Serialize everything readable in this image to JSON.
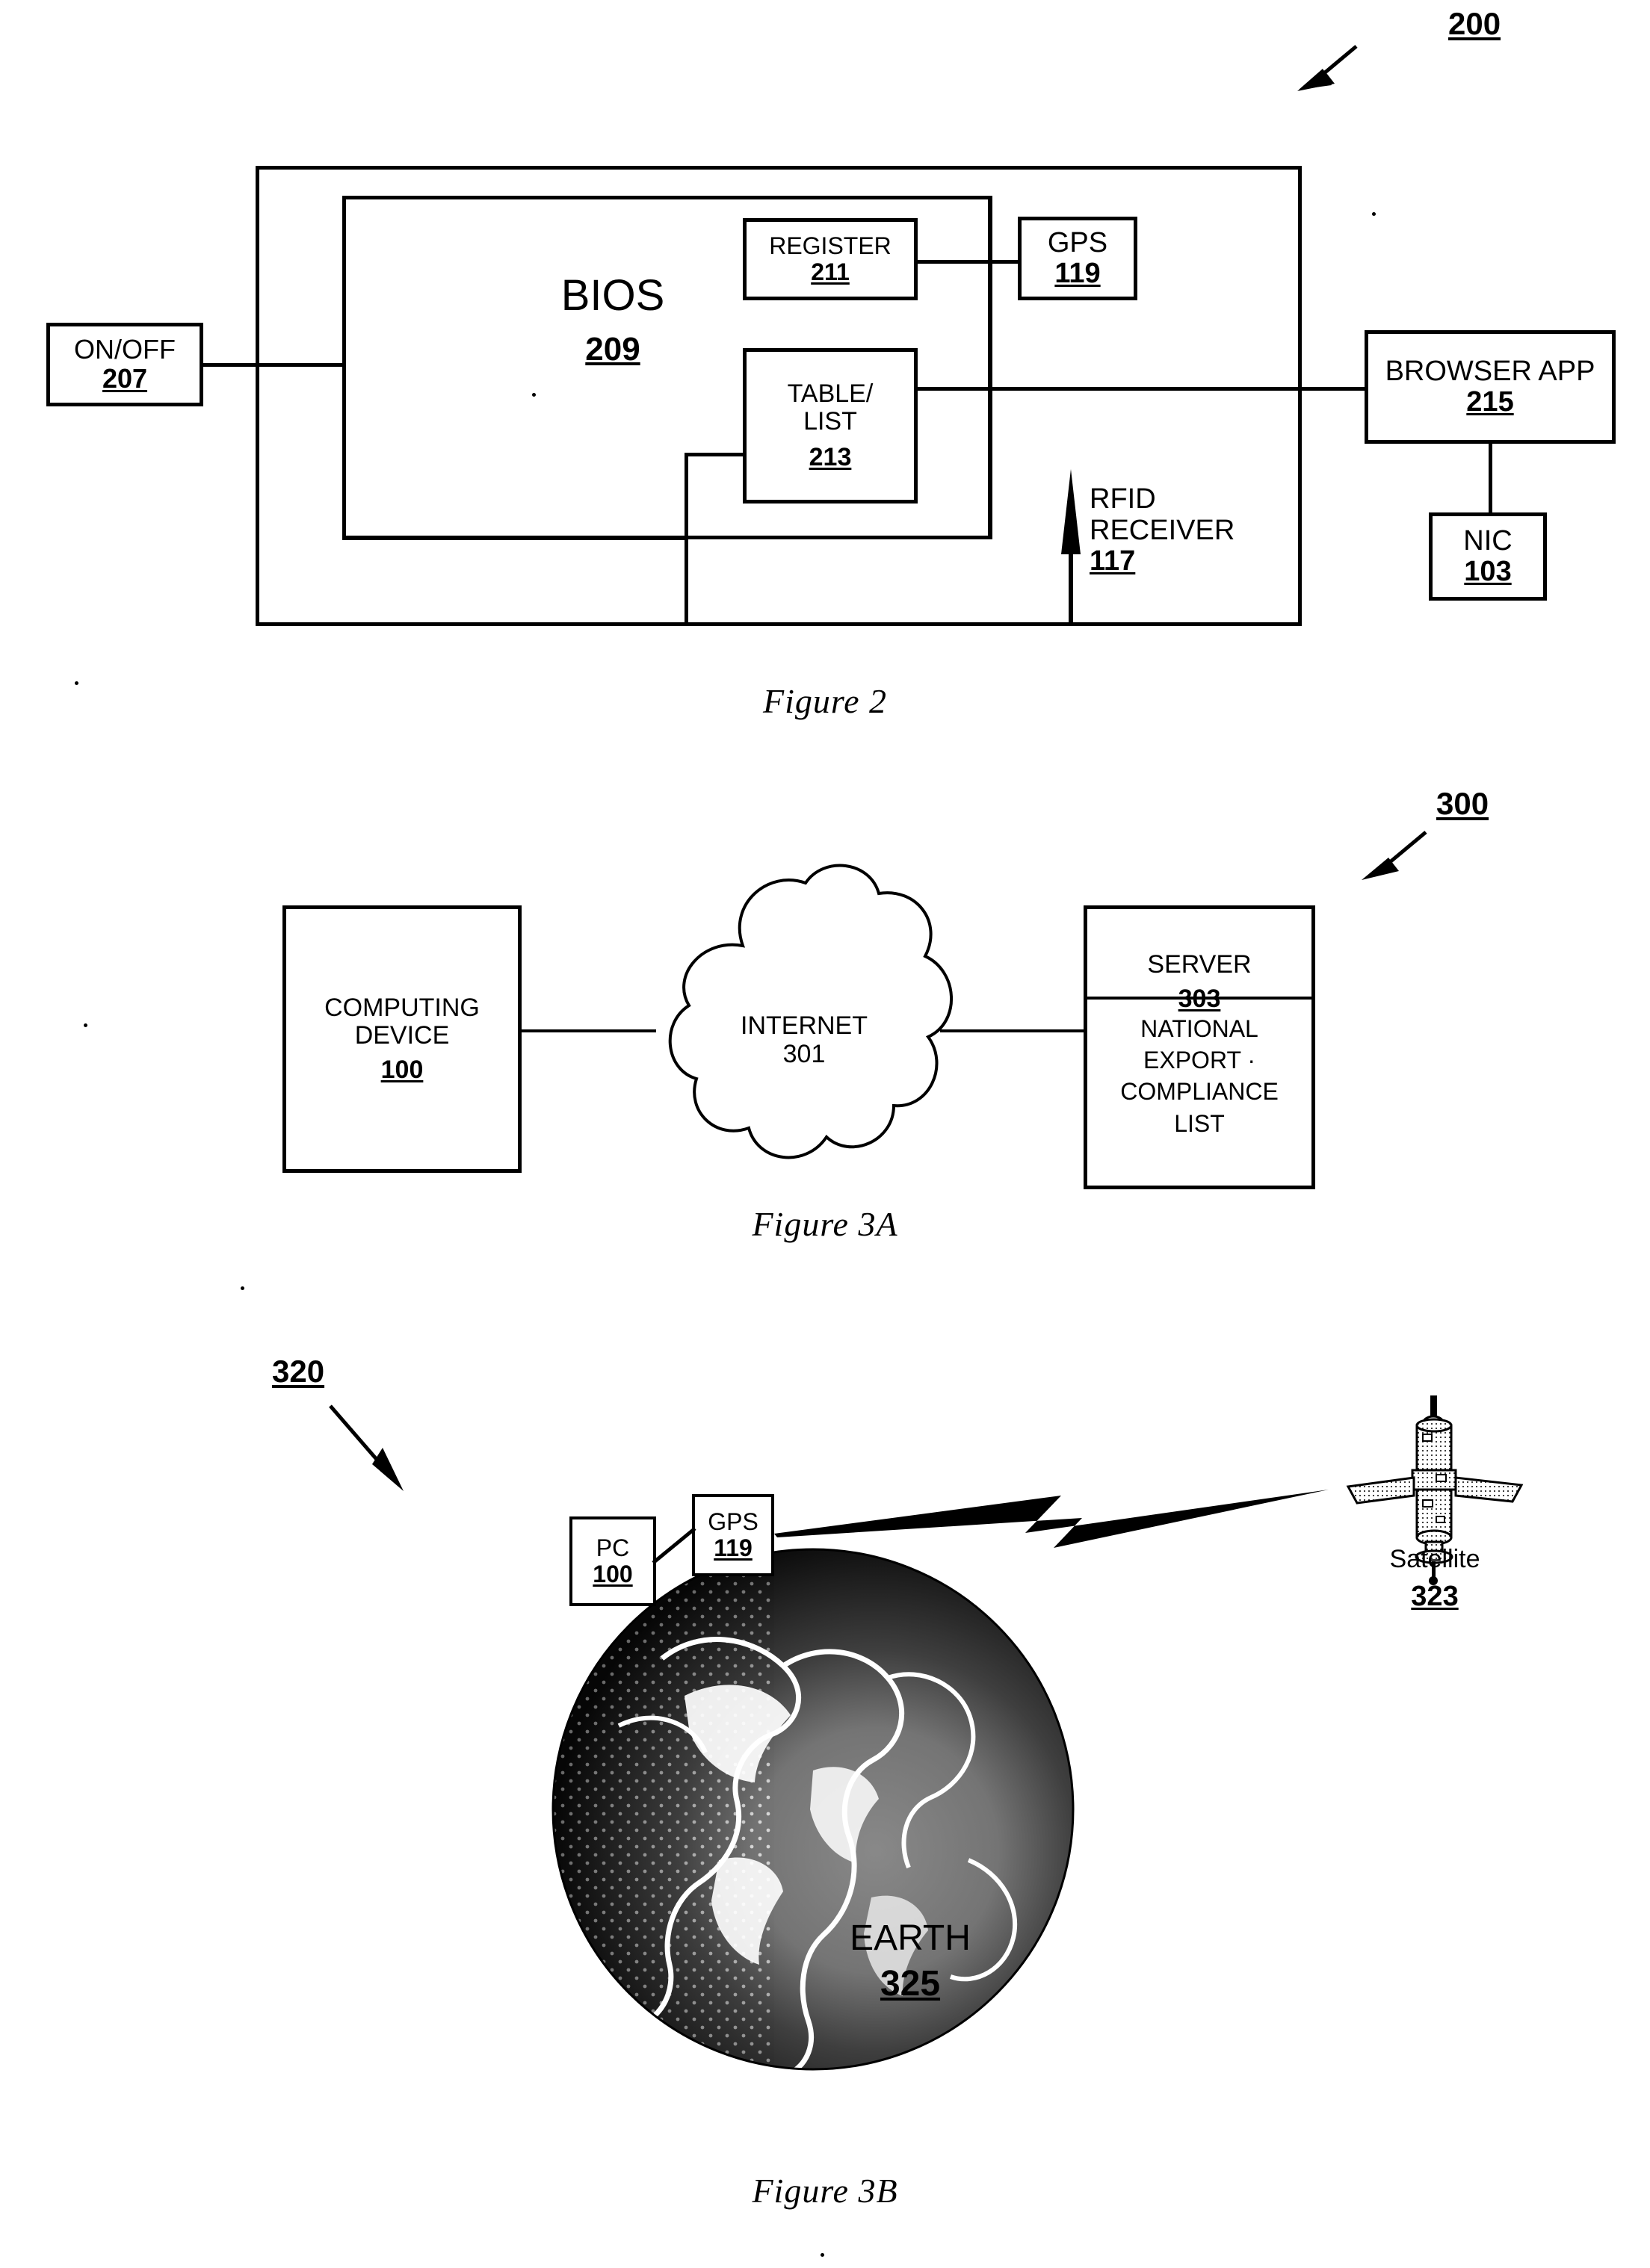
{
  "document": {
    "type": "patent-drawing-sheet",
    "figures": [
      "Figure 2",
      "Figure 3A",
      "Figure 3B"
    ]
  },
  "figure2": {
    "caption": "Figure 2",
    "callout": "200",
    "system_label": "200",
    "blocks": {
      "onoff": {
        "label": "ON/OFF",
        "ref": "207"
      },
      "bios": {
        "label": "BIOS",
        "ref": "209"
      },
      "register": {
        "label": "REGISTER",
        "ref": "211"
      },
      "gps": {
        "label": "GPS",
        "ref": "119"
      },
      "tablelist": {
        "label": "TABLE/\nLIST",
        "ref": "213"
      },
      "browser": {
        "label": "BROWSER APP",
        "ref": "215"
      },
      "nic": {
        "label": "NIC",
        "ref": "103"
      },
      "rfid": {
        "label": "RFID\nRECEIVER",
        "ref": "117"
      }
    }
  },
  "figure3a": {
    "caption": "Figure 3A",
    "callout": "300",
    "blocks": {
      "computing_device": {
        "label": "COMPUTING\nDEVICE",
        "ref": "100"
      },
      "internet": {
        "label": "INTERNET",
        "ref": "301"
      },
      "server": {
        "label": "SERVER",
        "ref": "303"
      },
      "list": {
        "label": "NATIONAL\nEXPORT  ·\nCOMPLIANCE\nLIST"
      }
    }
  },
  "figure3b": {
    "caption": "Figure 3B",
    "callout": "320",
    "blocks": {
      "pc": {
        "label": "PC",
        "ref": "100"
      },
      "gps": {
        "label": "GPS",
        "ref": "119"
      },
      "satellite": {
        "label": "Satellite",
        "ref": "323"
      },
      "earth": {
        "label": "EARTH",
        "ref": "325"
      }
    }
  },
  "colors": {
    "ink": "#000000",
    "paper": "#ffffff"
  }
}
